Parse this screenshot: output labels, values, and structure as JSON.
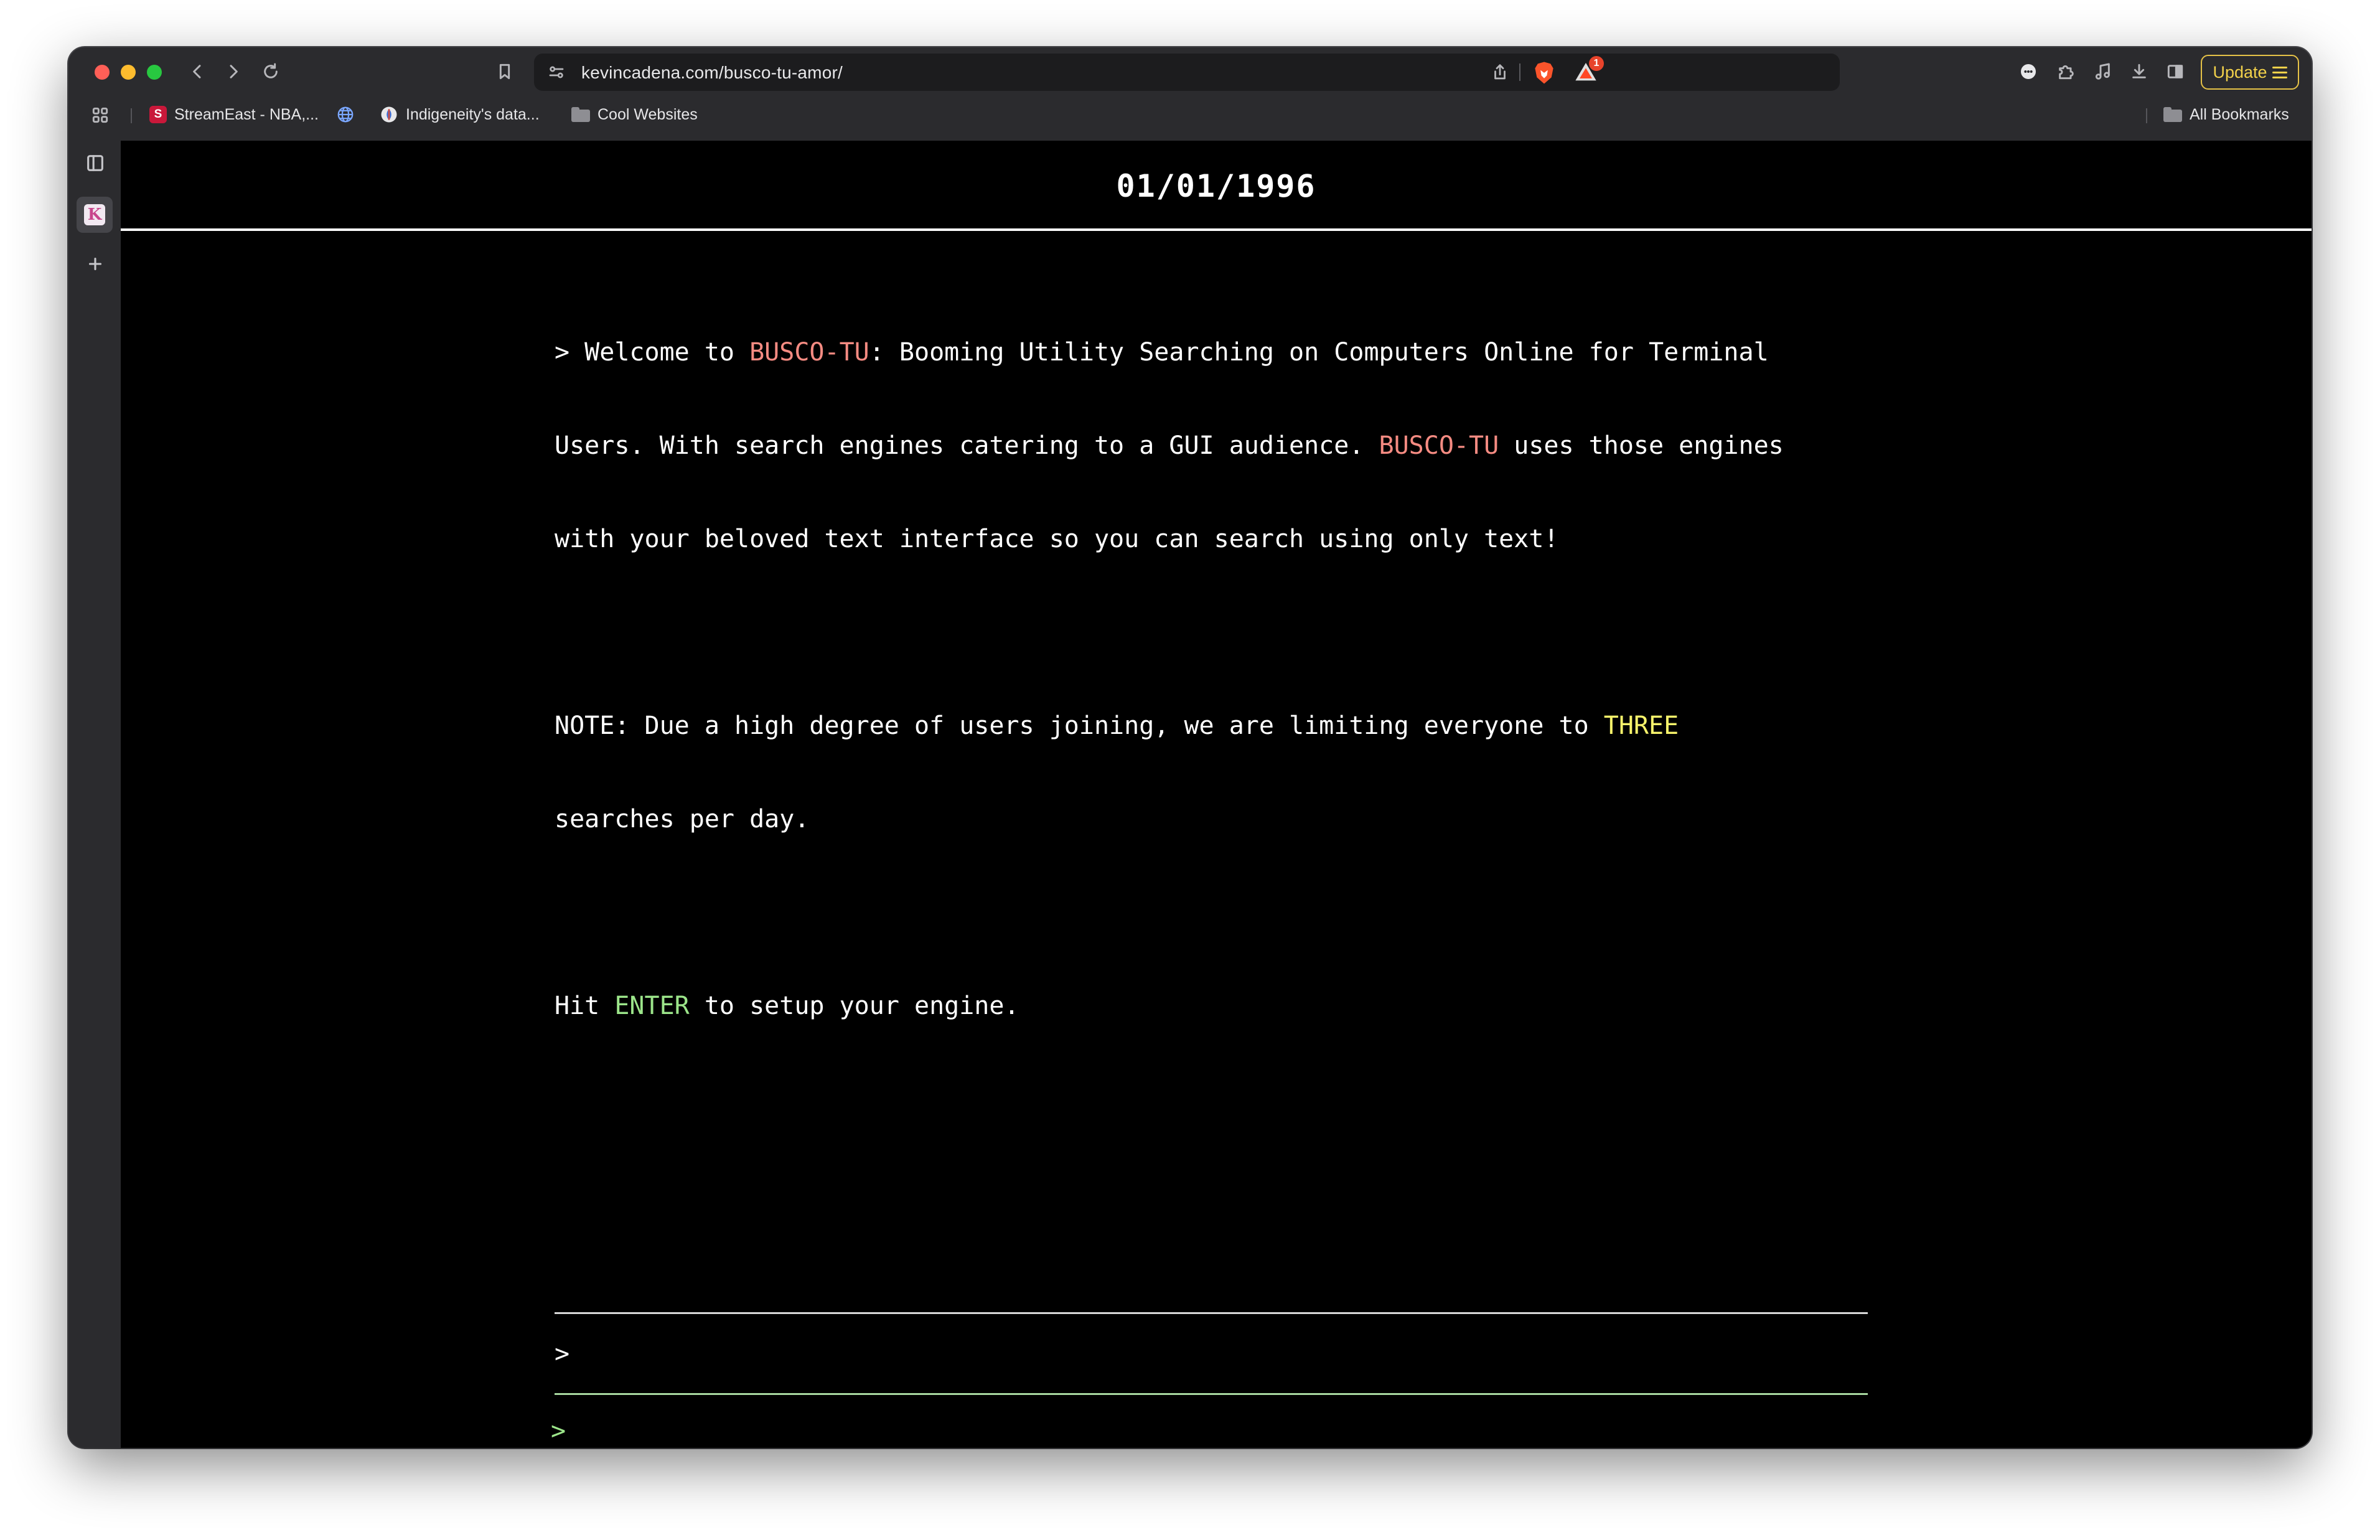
{
  "browser": {
    "url": "kevincadena.com/busco-tu-amor/",
    "notification_count": "1",
    "update_label": "Update",
    "colors": {
      "update_accent": "#f2d14a",
      "badge": "#e8432b"
    }
  },
  "bookmarks": {
    "items": [
      {
        "label": "StreamEast - NBA,...",
        "favicon": "S"
      },
      {
        "label": "Indigeneity's data...",
        "favicon": ""
      },
      {
        "label": "Cool Websites",
        "favicon": "folder"
      }
    ],
    "all_bookmarks_label": "All Bookmarks"
  },
  "page": {
    "date": "01/01/1996",
    "intro": {
      "p1": "> Welcome to ",
      "brand": "BUSCO-TU",
      "p2": ": Booming Utility Searching on Computers Online for Terminal",
      "p3": "Users. With search engines catering to a GUI audience. ",
      "p4": " uses those engines",
      "p5": "with your beloved text interface so you can search using only text!"
    },
    "note": {
      "p1": "NOTE: Due a high degree of users joining, we are limiting everyone to ",
      "highlight": "THREE",
      "p2": "searches per day."
    },
    "hint": {
      "p1": "Hit ",
      "key": "ENTER",
      "p2": " to setup your engine."
    },
    "prompt_output": ">",
    "prompt_input": ">",
    "colors": {
      "brand": "#f58b82",
      "highlight": "#f7f36b",
      "key": "#9ce58a",
      "background": "#000000"
    }
  }
}
